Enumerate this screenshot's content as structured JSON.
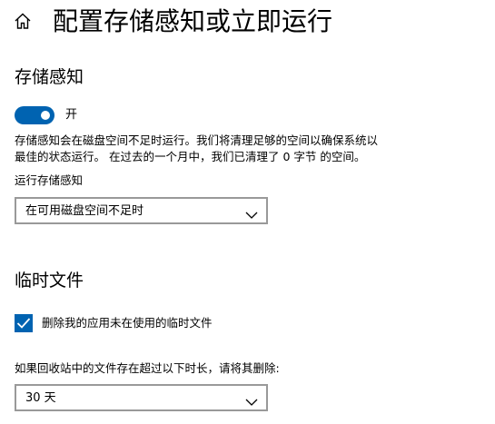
{
  "header": {
    "home_icon": "home-icon",
    "title": "配置存储感知或立即运行"
  },
  "storage_sense": {
    "title": "存储感知",
    "toggle": {
      "state": "on",
      "label": "开",
      "color": "#0063b1"
    },
    "description_line1": "存储感知会在磁盘空间不足时运行。我们将清理足够的空间以确保系统以",
    "description_line2": "最佳的状态运行。 在过去的一个月中，我们已清理了 0 字节 的空间。",
    "run_label": "运行存储感知",
    "run_dropdown": {
      "selected": "在可用磁盘空间不足时",
      "icon": "chevron-down-icon"
    }
  },
  "temp_files": {
    "title": "临时文件",
    "delete_unused_checkbox": {
      "checked": true,
      "label": "删除我的应用未在使用的临时文件",
      "icon": "checkmark-icon",
      "color": "#0063b1"
    },
    "recycle_label": "如果回收站中的文件存在超过以下时长，请将其删除:",
    "recycle_dropdown": {
      "selected": "30 天",
      "icon": "chevron-down-icon"
    }
  }
}
